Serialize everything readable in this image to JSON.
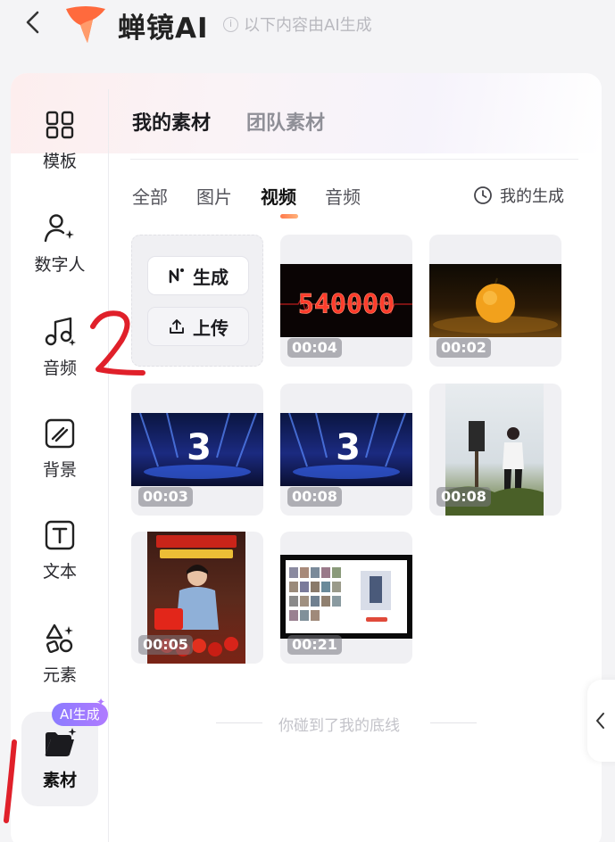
{
  "header": {
    "brand": "蝉镜AI",
    "ai_notice": "以下内容由AI生成"
  },
  "sidebar": {
    "items": [
      {
        "label": "模板",
        "icon": "grid-layout-icon"
      },
      {
        "label": "数字人",
        "icon": "person-sparkle-icon"
      },
      {
        "label": "音频",
        "icon": "music-note-icon"
      },
      {
        "label": "背景",
        "icon": "background-pattern-icon"
      },
      {
        "label": "文本",
        "icon": "text-box-icon"
      },
      {
        "label": "元素",
        "icon": "shapes-icon"
      },
      {
        "label": "素材",
        "icon": "folder-sparkle-icon"
      }
    ],
    "active": "素材",
    "ai_badge": "AI生成"
  },
  "section_tabs": [
    "我的素材",
    "团队素材"
  ],
  "section_active": "我的素材",
  "filter_tabs": [
    "全部",
    "图片",
    "视频",
    "音频"
  ],
  "filter_active": "视频",
  "my_generations": "我的生成",
  "actions": {
    "generate_label": "生成",
    "upload_label": "上传"
  },
  "media": [
    {
      "duration": "00:04",
      "caption": "540000",
      "kind": "neon-counter"
    },
    {
      "duration": "00:02",
      "kind": "orange-fruit"
    },
    {
      "duration": "00:03",
      "caption": "3",
      "kind": "countdown"
    },
    {
      "duration": "00:08",
      "caption": "3",
      "kind": "countdown"
    },
    {
      "duration": "00:08",
      "kind": "hiker-portrait"
    },
    {
      "duration": "00:05",
      "kind": "food-promo"
    },
    {
      "duration": "00:21",
      "kind": "web-screenshot"
    }
  ],
  "end_message": "你碰到了我的底线",
  "annotations": [
    "2"
  ],
  "colors": {
    "accent_orange": "#ff7a4d",
    "ai_badge": "#8b7bff",
    "annotation_red": "#e0202a"
  }
}
